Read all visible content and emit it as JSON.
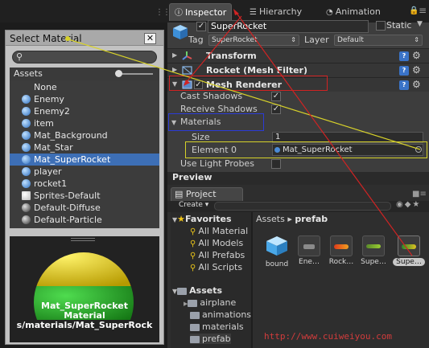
{
  "tabs": [
    {
      "label": "Inspector",
      "icon": "info-icon",
      "active": true
    },
    {
      "label": "Hierarchy",
      "icon": "list-icon",
      "active": false
    },
    {
      "label": "Animation",
      "icon": "clock-icon",
      "active": false
    }
  ],
  "inspector": {
    "object_name": "SuperRocket",
    "static_label": "Static",
    "tag_label": "Tag",
    "tag_value": "SuperRocket",
    "layer_label": "Layer",
    "layer_value": "Default",
    "components": [
      {
        "title": "Transform",
        "icon": "transform-icon"
      },
      {
        "title": "Rocket (Mesh Filter)",
        "icon": "mesh-filter-icon"
      },
      {
        "title": "Mesh Renderer",
        "icon": "mesh-renderer-icon"
      }
    ],
    "cast_shadows_label": "Cast Shadows",
    "receive_shadows_label": "Receive Shadows",
    "materials_label": "Materials",
    "size_label": "Size",
    "size_value": "1",
    "element0_label": "Element 0",
    "element0_value": "Mat_SuperRocket",
    "use_light_probes_label": "Use Light Probes"
  },
  "preview_label": "Preview",
  "project": {
    "tab_label": "Project",
    "create_label": "Create ▾",
    "favorites_label": "Favorites",
    "favorites": [
      "All Material",
      "All Models",
      "All Prefabs",
      "All Scripts"
    ],
    "assets_label": "Assets",
    "folders": [
      "airplane",
      "animations",
      "materials",
      "prefab"
    ],
    "breadcrumb_root": "Assets",
    "breadcrumb_sep": "▸",
    "breadcrumb_current": "prefab",
    "items": [
      {
        "label": "bound",
        "color": "#4aa8e8"
      },
      {
        "label": "Ene…",
        "color": "#8a8a8a"
      },
      {
        "label": "Rock…",
        "color": "#d04a2a"
      },
      {
        "label": "Supe…",
        "color": "#6a8a3a"
      },
      {
        "label": "Supe…",
        "color": "#3a8a3a"
      }
    ]
  },
  "watermark": "http://www.cuiweiyou.com",
  "popup": {
    "title": "Select Material",
    "close_label": "✕",
    "assets_label": "Assets",
    "materials": [
      {
        "label": "None",
        "ball": "none"
      },
      {
        "label": "Enemy",
        "ball": "blue"
      },
      {
        "label": "Enemy2",
        "ball": "blue"
      },
      {
        "label": "item",
        "ball": "blue"
      },
      {
        "label": "Mat_Background",
        "ball": "blue"
      },
      {
        "label": "Mat_Star",
        "ball": "blue"
      },
      {
        "label": "Mat_SuperRocket",
        "ball": "blue",
        "selected": true
      },
      {
        "label": "player",
        "ball": "blue"
      },
      {
        "label": "rocket1",
        "ball": "blue"
      },
      {
        "label": "Sprites-Default",
        "ball": "white"
      },
      {
        "label": "Default-Diffuse",
        "ball": "grey"
      },
      {
        "label": "Default-Particle",
        "ball": "grey"
      }
    ],
    "preview_name": "Mat_SuperRocket",
    "preview_type": "Material",
    "preview_path": "s/materials/Mat_SuperRock"
  },
  "colors": {
    "red_annotation": "#d12323",
    "yellow_annotation": "#d5d12a",
    "blue_annotation": "#2b3bd6",
    "selection_blue": "#3d6fb6"
  }
}
